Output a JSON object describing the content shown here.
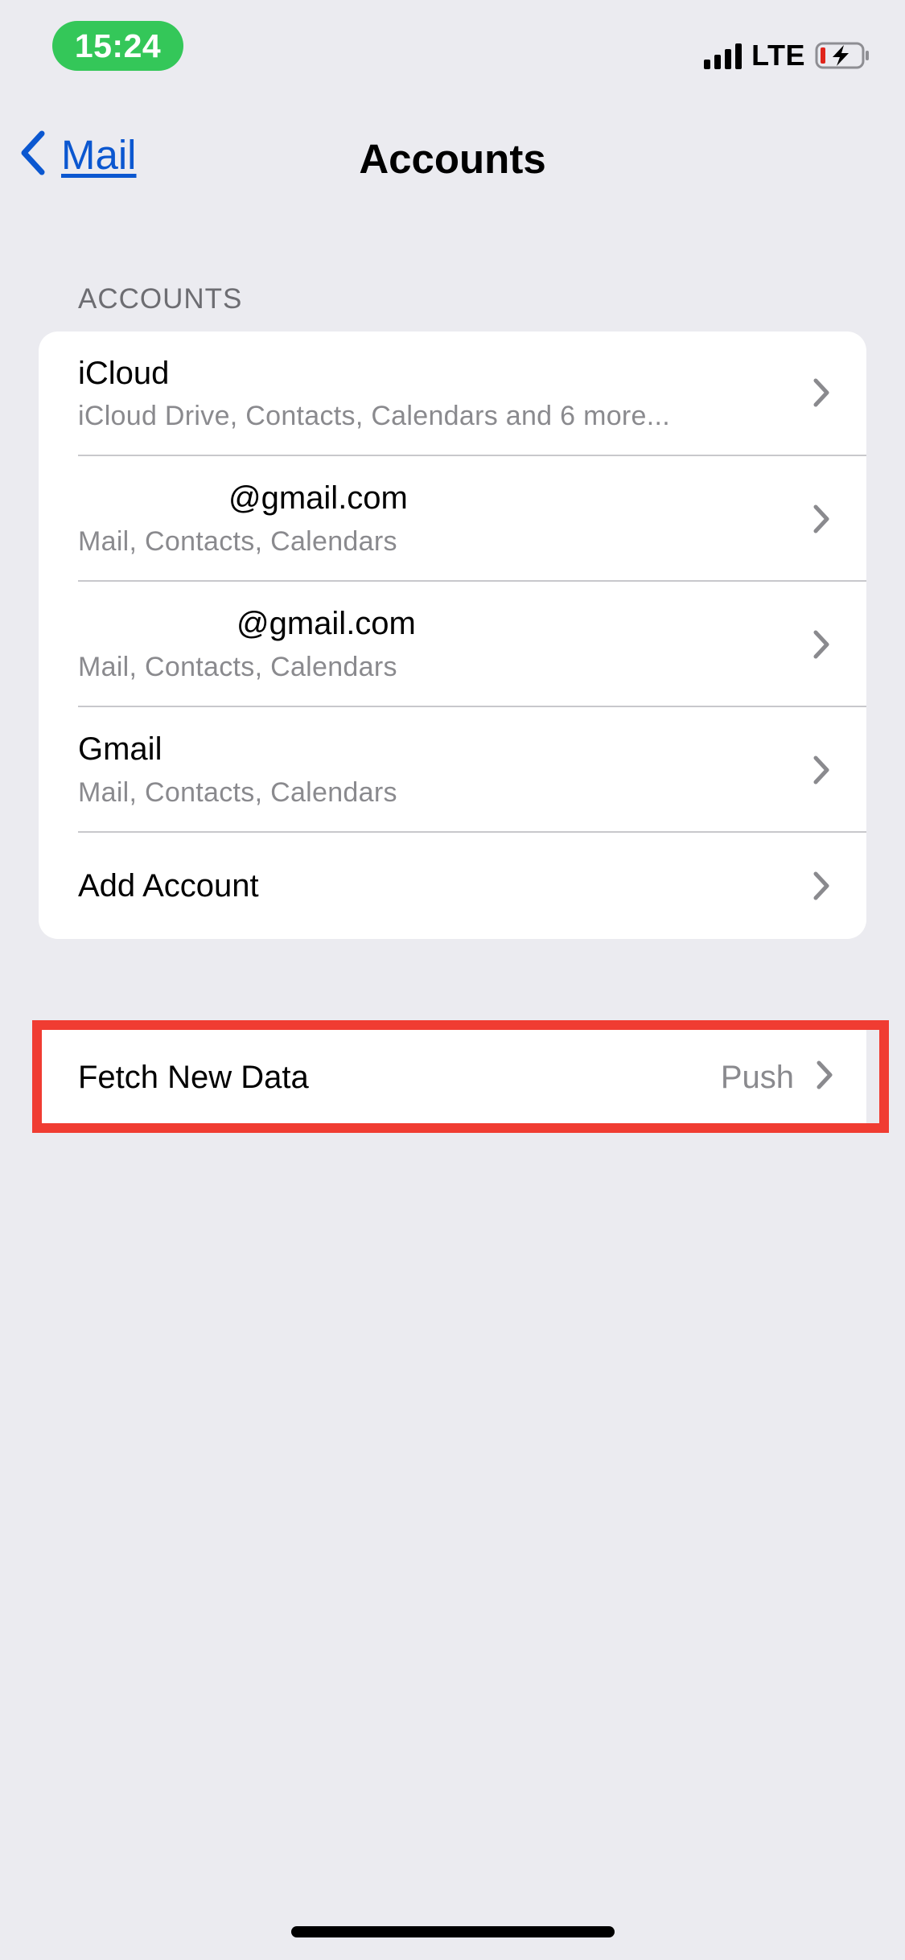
{
  "status_bar": {
    "time": "15:24",
    "network": "LTE",
    "icons": [
      "signal-icon",
      "battery-charging-icon"
    ],
    "time_pill_color": "#34c759"
  },
  "nav": {
    "back_label": "Mail",
    "title": "Accounts",
    "back_icon": "chevron-left-icon",
    "link_color": "#0b57d0"
  },
  "accounts_section": {
    "header": "ACCOUNTS",
    "rows": [
      {
        "title": "iCloud",
        "subtitle": "iCloud Drive, Contacts, Calendars and 6 more..."
      },
      {
        "title": "@gmail.com",
        "subtitle": "Mail, Contacts, Calendars"
      },
      {
        "title": "@gmail.com",
        "subtitle": "Mail, Contacts, Calendars"
      },
      {
        "title": "Gmail",
        "subtitle": "Mail, Contacts, Calendars"
      }
    ],
    "add_account": "Add Account"
  },
  "fetch": {
    "label": "Fetch New Data",
    "value": "Push",
    "highlight_color": "#f03c32"
  }
}
